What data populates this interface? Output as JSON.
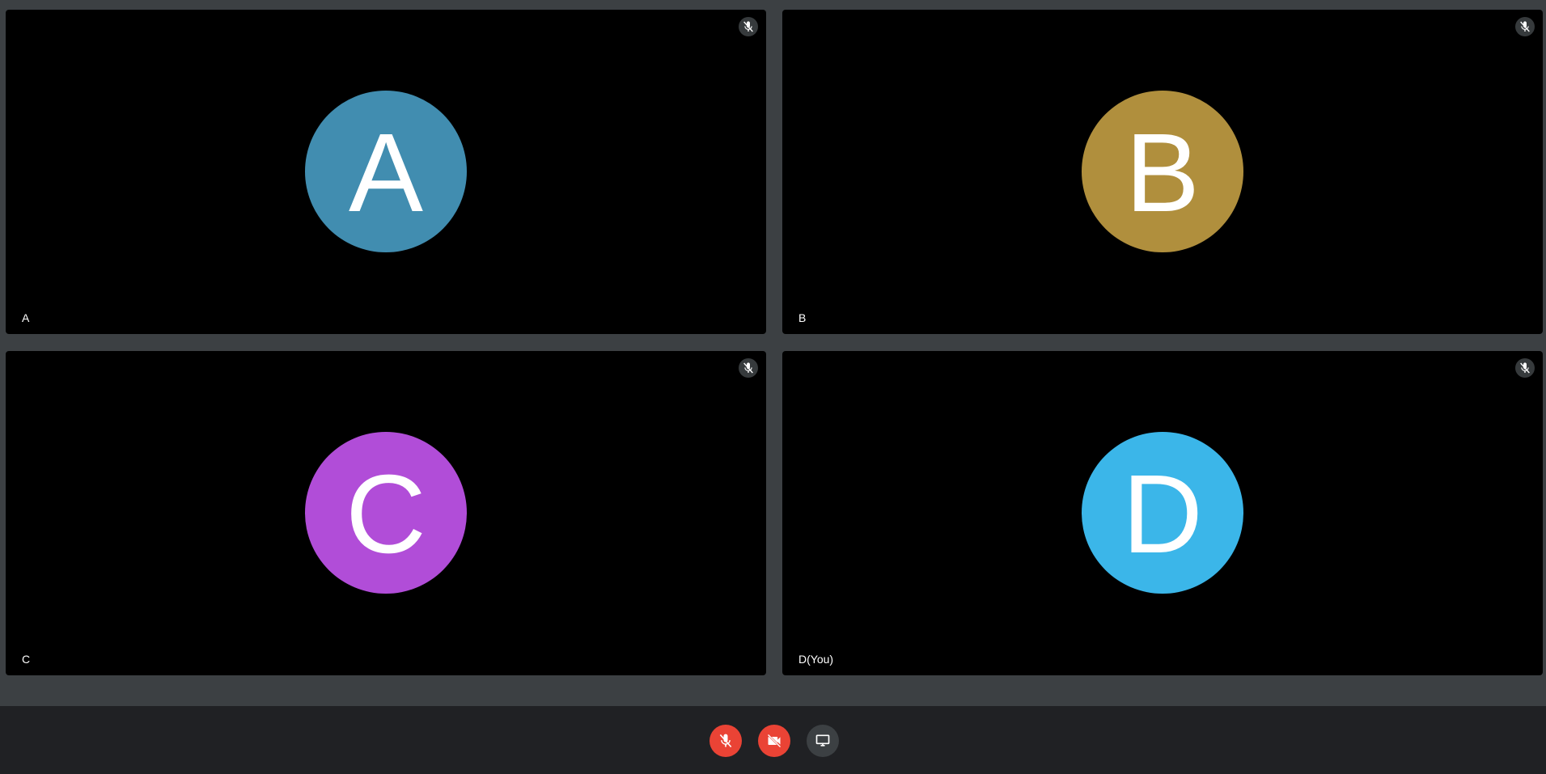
{
  "participants": [
    {
      "initial": "A",
      "name": "A",
      "avatar_color": "#418db0",
      "muted": true
    },
    {
      "initial": "B",
      "name": "B",
      "avatar_color": "#b08f3d",
      "muted": true
    },
    {
      "initial": "C",
      "name": "C",
      "avatar_color": "#b14dd8",
      "muted": true
    },
    {
      "initial": "D",
      "name": "D(You)",
      "avatar_color": "#3bb6e9",
      "muted": true
    }
  ],
  "controls": {
    "mic": {
      "icon": "mic-off-icon",
      "state": "off",
      "color": "#ea4335"
    },
    "camera": {
      "icon": "camera-off-icon",
      "state": "off",
      "color": "#ea4335"
    },
    "share": {
      "icon": "screen-share-icon",
      "color": "#3c4043"
    }
  }
}
